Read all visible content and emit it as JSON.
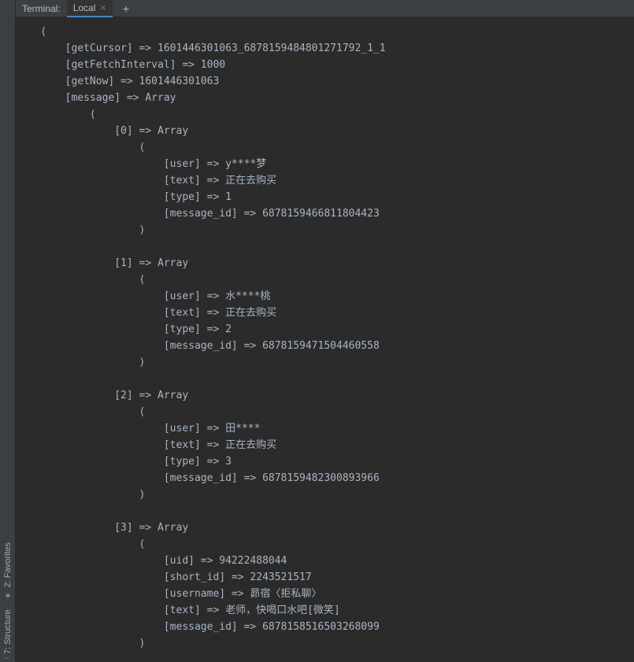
{
  "tabbar": {
    "label": "Terminal:",
    "tab_name": "Local",
    "close_glyph": "×",
    "add_glyph": "+"
  },
  "left_gutter": {
    "favorites": {
      "icon": "★",
      "label": "2: Favorites"
    },
    "structure": {
      "icon": "⦙",
      "label": "7: Structure"
    }
  },
  "dump": {
    "getCursor": "1601446301063_6878159484801271792_1_1",
    "getFetchInterval": "1000",
    "getNow": "1601446301063",
    "message_keyword": "Array",
    "messages": [
      {
        "index": 0,
        "fields": {
          "user": "y****梦",
          "text": "正在去购买",
          "type": "1",
          "message_id": "6878159466811804423"
        }
      },
      {
        "index": 1,
        "fields": {
          "user": "水****桃",
          "text": "正在去购买",
          "type": "2",
          "message_id": "6878159471504460558"
        }
      },
      {
        "index": 2,
        "fields": {
          "user": "田****",
          "text": "正在去购买",
          "type": "3",
          "message_id": "6878159482300893966"
        }
      },
      {
        "index": 3,
        "fields": {
          "uid": "94222488044",
          "short_id": "2243521517",
          "username": "昴宿〈拒私聊〉",
          "text": "老师，快喝口水吧[微笑]",
          "message_id": "6878158516503268099"
        }
      }
    ],
    "arrow": "=>",
    "paren_open": "(",
    "paren_close": ")"
  }
}
